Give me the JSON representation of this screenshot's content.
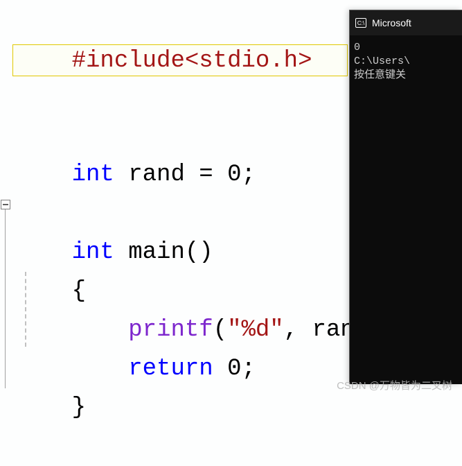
{
  "code": {
    "include_directive": "#include",
    "include_header": "<stdio.h>",
    "type_int": "int",
    "decl_name": " rand = 0;",
    "main_name": " main()",
    "brace_open": "{",
    "printf_indent": "    ",
    "printf_name": "printf",
    "printf_open": "(",
    "printf_str": "\"%d\"",
    "printf_rest": ", rand)",
    "return_indent": "    ",
    "return_kw": "return",
    "return_val": " 0;",
    "brace_close": "}"
  },
  "console": {
    "icon_text": "C:\\",
    "title": "Microsoft",
    "output_line1": "0",
    "output_line2": "C:\\Users\\",
    "output_line3": "按任意键关"
  },
  "watermark": "CSDN @万物皆为二叉树"
}
